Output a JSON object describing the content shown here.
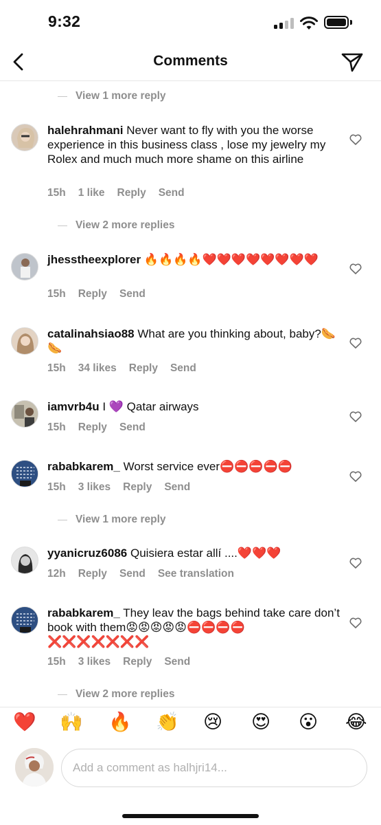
{
  "status_bar": {
    "time": "9:32"
  },
  "nav": {
    "title": "Comments"
  },
  "view_more": [
    {
      "label": "View 1 more reply"
    },
    {
      "label": "View 2 more replies"
    },
    {
      "label": "View 1 more reply"
    },
    {
      "label": "View 2 more replies"
    }
  ],
  "comments": [
    {
      "username": "halehrahmani",
      "text": "Never want to fly with you the worse experience in this business class , lose my jewelry my Rolex and much much more shame on this airline",
      "time": "15h",
      "likes": "1 like",
      "reply": "Reply",
      "send": "Send"
    },
    {
      "username": "jhesstheexplorer",
      "text": "🔥🔥🔥🔥❤️❤️❤️❤️❤️❤️❤️❤️",
      "time": "15h",
      "reply": "Reply",
      "send": "Send"
    },
    {
      "username": "catalinahsiao88",
      "text": "What are you thinking about, baby?🌭🌭",
      "time": "15h",
      "likes": "34 likes",
      "reply": "Reply",
      "send": "Send"
    },
    {
      "username": "iamvrb4u",
      "text": "I 💜 Qatar airways",
      "time": "15h",
      "reply": "Reply",
      "send": "Send"
    },
    {
      "username": "rababkarem_",
      "text": "Worst service ever⛔⛔⛔⛔⛔",
      "time": "15h",
      "likes": "3 likes",
      "reply": "Reply",
      "send": "Send"
    },
    {
      "username": "yyanicruz6086",
      "text": "Quisiera estar allí ....❤️❤️❤️",
      "time": "12h",
      "reply": "Reply",
      "send": "Send",
      "translate": "See translation"
    },
    {
      "username": "rababkarem_",
      "text": "They leav the bags behind take care don’t book with them😡😡😡😡😡⛔⛔⛔⛔❌❌❌❌❌❌❌",
      "time": "15h",
      "likes": "3 likes",
      "reply": "Reply",
      "send": "Send"
    }
  ],
  "reactions": [
    {
      "emoji": "❤️",
      "icon": "red-heart"
    },
    {
      "emoji": "🙌",
      "icon": "raising-hands"
    },
    {
      "emoji": "🔥",
      "icon": "fire"
    },
    {
      "emoji": "👏",
      "icon": "clapping-hands"
    },
    {
      "emoji": "😢",
      "icon": "crying-face"
    },
    {
      "emoji": "😍",
      "icon": "heart-eyes"
    },
    {
      "emoji": "😮",
      "icon": "surprised-face"
    },
    {
      "emoji": "😂",
      "icon": "tears-of-joy"
    }
  ],
  "composer": {
    "placeholder": "Add a comment as halhjri14..."
  },
  "colors": {
    "muted": "#8e8e8e",
    "text": "#111111",
    "divider": "#e6e6e6"
  }
}
